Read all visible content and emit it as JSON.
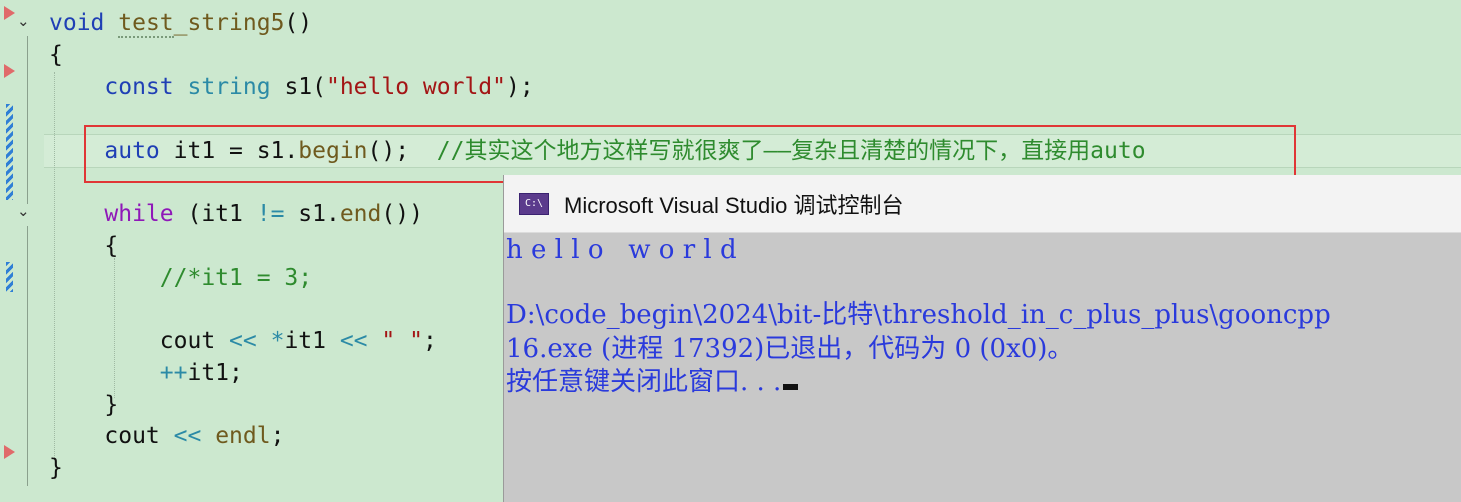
{
  "editor": {
    "lines": [
      {
        "name": "line-func-decl",
        "parts": [
          {
            "c": "kw",
            "t": "void"
          },
          {
            "c": "",
            "t": " "
          },
          {
            "c": "fn squig",
            "t": "test"
          },
          {
            "c": "fn",
            "t": "_string5"
          },
          {
            "c": "",
            "t": "()"
          }
        ]
      },
      {
        "name": "line-open-brace",
        "parts": [
          {
            "c": "",
            "t": "{"
          }
        ]
      },
      {
        "name": "line-const-string",
        "parts": [
          {
            "c": "",
            "t": "    "
          },
          {
            "c": "kw",
            "t": "const"
          },
          {
            "c": "",
            "t": " "
          },
          {
            "c": "kw2",
            "t": "string"
          },
          {
            "c": "",
            "t": " s1("
          },
          {
            "c": "str",
            "t": "\"hello world\""
          },
          {
            "c": "",
            "t": ");"
          }
        ]
      },
      {
        "name": "line-blank-1",
        "parts": []
      },
      {
        "name": "line-auto-it1",
        "parts": [
          {
            "c": "",
            "t": "    "
          },
          {
            "c": "kw",
            "t": "auto"
          },
          {
            "c": "",
            "t": " it1 = s1."
          },
          {
            "c": "fn",
            "t": "begin"
          },
          {
            "c": "",
            "t": "();  "
          },
          {
            "c": "cmt",
            "t": "//其实这个地方这样写就很爽了——复杂且清楚的情况下，直接用auto"
          }
        ]
      },
      {
        "name": "line-blank-2",
        "parts": []
      },
      {
        "name": "line-while",
        "parts": [
          {
            "c": "",
            "t": "    "
          },
          {
            "c": "ctl",
            "t": "while"
          },
          {
            "c": "",
            "t": " (it1 "
          },
          {
            "c": "kw2",
            "t": "!="
          },
          {
            "c": "",
            "t": " s1."
          },
          {
            "c": "fn",
            "t": "end"
          },
          {
            "c": "",
            "t": "())"
          }
        ]
      },
      {
        "name": "line-while-open",
        "parts": [
          {
            "c": "",
            "t": "    {"
          }
        ]
      },
      {
        "name": "line-comment-assign",
        "parts": [
          {
            "c": "",
            "t": "        "
          },
          {
            "c": "cmt",
            "t": "//*it1 = 3;"
          }
        ]
      },
      {
        "name": "line-blank-3",
        "parts": []
      },
      {
        "name": "line-cout-it1",
        "parts": [
          {
            "c": "",
            "t": "        cout "
          },
          {
            "c": "kw2",
            "t": "<<"
          },
          {
            "c": "",
            "t": " "
          },
          {
            "c": "kw2",
            "t": "*"
          },
          {
            "c": "",
            "t": "it1 "
          },
          {
            "c": "kw2",
            "t": "<<"
          },
          {
            "c": "",
            "t": " "
          },
          {
            "c": "str",
            "t": "\" \""
          },
          {
            "c": "",
            "t": ";"
          }
        ]
      },
      {
        "name": "line-increment",
        "parts": [
          {
            "c": "",
            "t": "        "
          },
          {
            "c": "kw2",
            "t": "++"
          },
          {
            "c": "",
            "t": "it1;"
          }
        ]
      },
      {
        "name": "line-while-close",
        "parts": [
          {
            "c": "",
            "t": "    }"
          }
        ]
      },
      {
        "name": "line-cout-endl",
        "parts": [
          {
            "c": "",
            "t": "    cout "
          },
          {
            "c": "kw2",
            "t": "<<"
          },
          {
            "c": "",
            "t": " "
          },
          {
            "c": "fn",
            "t": "endl"
          },
          {
            "c": "",
            "t": ";"
          }
        ]
      },
      {
        "name": "line-close-brace",
        "parts": [
          {
            "c": "",
            "t": "}"
          }
        ]
      }
    ],
    "colors": {
      "background": "#cce8cf",
      "keyword": "#1f3fb5",
      "string": "#a31515",
      "comment": "#2e8b2e",
      "highlight_box": "#e03636"
    }
  },
  "console": {
    "title": "Microsoft Visual Studio 调试控制台",
    "icon_label": "C:\\",
    "lines": [
      "h e l l o   w o r l d",
      "",
      "D:\\code_begin\\2024\\bit-比特\\threshold_in_c_plus_plus\\gooncpp",
      "16.exe (进程 17392)已退出，代码为 0 (0x0)。",
      "按任意键关闭此窗口. . ."
    ],
    "colors": {
      "text": "#2a3adc",
      "background": "#c8c8c8"
    }
  }
}
